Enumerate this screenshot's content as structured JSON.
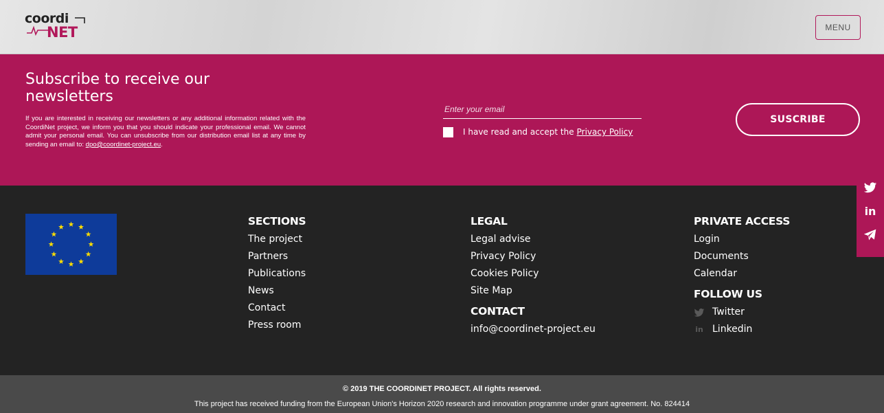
{
  "header": {
    "logo_top": "coordi",
    "logo_bottom": "NET",
    "menu_label": "MENU"
  },
  "newsletter": {
    "title": "Subscribe to receive our newsletters",
    "description": "If you are interested in receiving our newsletters or any additional information related with the CoordiNet project, we inform you that you should indicate your professional email. We cannot admit your personal email. You can unsubscribe from our distribution email list at any time by sending an email to:",
    "contact_email": "dpo@coordinet-project.eu",
    "email_placeholder": "Enter your email",
    "consent_text": "I have read and accept the",
    "consent_link": "Privacy Policy",
    "subscribe_label": "SUSCRIBE"
  },
  "social": [
    {
      "icon": "twitter-icon",
      "glyph": "🐦"
    },
    {
      "icon": "linkedin-icon",
      "glyph": "in"
    },
    {
      "icon": "telegram-icon",
      "glyph": "✈"
    }
  ],
  "footer": {
    "sections": {
      "title": "SECTIONS",
      "links": [
        "The project",
        "Partners",
        "Publications",
        "News",
        "Contact",
        "Press room"
      ]
    },
    "legal": {
      "title": "LEGAL",
      "links": [
        "Legal advise",
        "Privacy Policy",
        "Cookies Policy",
        "Site Map"
      ]
    },
    "contact": {
      "title": "CONTACT",
      "email": "info@coordinet-project.eu"
    },
    "private_access": {
      "title": "PRIVATE ACCESS",
      "links": [
        "Login",
        "Documents",
        "Calendar"
      ]
    },
    "follow_us": {
      "title": "FOLLOW US",
      "links": [
        {
          "label": "Twitter",
          "icon": "twitter-icon",
          "glyph": "🐦"
        },
        {
          "label": "Linkedin",
          "icon": "linkedin-icon",
          "glyph": "in"
        }
      ]
    }
  },
  "bottom": {
    "copyright": "© 2019 THE COORDINET PROJECT. All rights reserved.",
    "funding": "This project has received funding from the European Union's Horizon 2020 research and innovation programme under grant agreement. No. 824414"
  },
  "colors": {
    "brand": "#ad1757",
    "footer_bg": "#232323",
    "bottom_bg": "#4a4a4a",
    "eu_blue": "#0e3b9a",
    "eu_gold": "#ffdd00"
  }
}
